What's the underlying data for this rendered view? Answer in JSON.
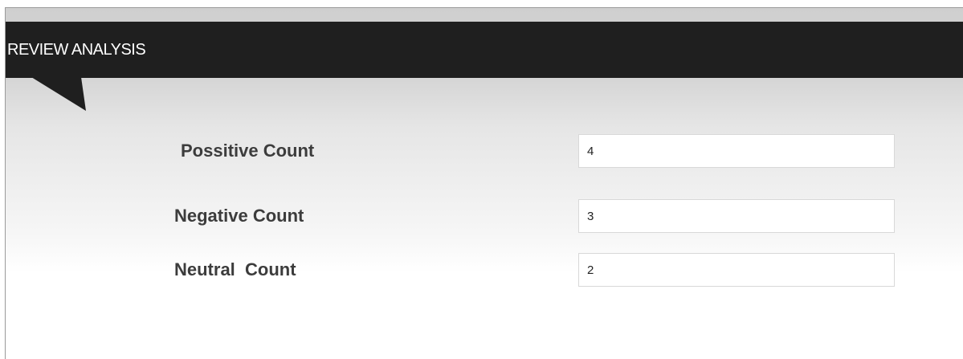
{
  "header": {
    "title": "REVIEW ANALYSIS"
  },
  "fields": [
    {
      "label": "Possitive Count",
      "value": "4"
    },
    {
      "label": "Negative Count",
      "value": "3"
    },
    {
      "label": "Neutral  Count",
      "value": "2"
    }
  ],
  "colors": {
    "header_background": "#1f1f1f",
    "header_text": "#ffffff",
    "label_text": "#3c3c3c"
  }
}
